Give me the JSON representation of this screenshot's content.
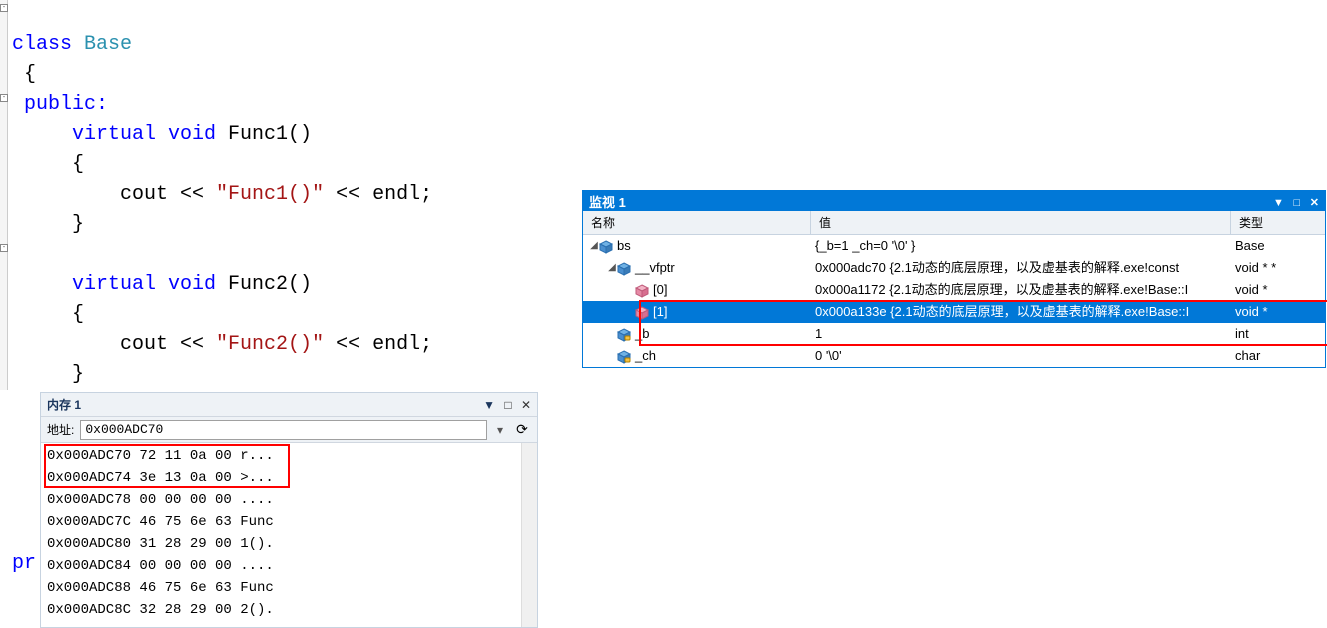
{
  "code": {
    "l1a": "class",
    "l1b": " Base",
    "l2": " {",
    "l3": " public:",
    "l4a": "     virtual",
    "l4b": " void",
    "l4c": " Func1()",
    "l5": "     {",
    "l6a": "         cout << ",
    "l6str": "\"Func1()\"",
    "l6b": " << endl;",
    "l7": "     }",
    "l8": "",
    "l9a": "     virtual",
    "l9b": " void",
    "l9c": " Func2()",
    "l10": "     {",
    "l11a": "         cout << ",
    "l11str": "\"Func2()\"",
    "l11b": " << endl;",
    "l12": "     }",
    "pri": "pr"
  },
  "mem": {
    "title": "内存 1",
    "addr_label": "地址:",
    "addr_value": "0x000ADC70",
    "rows": [
      {
        "a": "0x000ADC70",
        "b": "72 11 0a 00",
        "t": "r..."
      },
      {
        "a": "0x000ADC74",
        "b": "3e 13 0a 00",
        "t": ">..."
      },
      {
        "a": "0x000ADC78",
        "b": "00 00 00 00",
        "t": "...."
      },
      {
        "a": "0x000ADC7C",
        "b": "46 75 6e 63",
        "t": "Func"
      },
      {
        "a": "0x000ADC80",
        "b": "31 28 29 00",
        "t": "1()."
      },
      {
        "a": "0x000ADC84",
        "b": "00 00 00 00",
        "t": "...."
      },
      {
        "a": "0x000ADC88",
        "b": "46 75 6e 63",
        "t": "Func"
      },
      {
        "a": "0x000ADC8C",
        "b": "32 28 29 00",
        "t": "2()."
      }
    ]
  },
  "watch": {
    "title": "监视 1",
    "hdr_name": "名称",
    "hdr_value": "值",
    "hdr_type": "类型",
    "rows": [
      {
        "indent": 0,
        "exp": "▼",
        "icon": "blue",
        "name": "bs",
        "value": "{_b=1 _ch=0 '\\0' }",
        "type": "Base",
        "sel": false
      },
      {
        "indent": 1,
        "exp": "▼",
        "icon": "blue",
        "name": "__vfptr",
        "value": "0x000adc70 {2.1动态的底层原理，以及虚基表的解释.exe!const",
        "type": "void * *",
        "sel": false
      },
      {
        "indent": 2,
        "exp": "",
        "icon": "pink",
        "name": "[0]",
        "value": "0x000a1172 {2.1动态的底层原理，以及虚基表的解释.exe!Base::I",
        "type": "void *",
        "sel": false
      },
      {
        "indent": 2,
        "exp": "",
        "icon": "pink",
        "name": "[1]",
        "value": "0x000a133e {2.1动态的底层原理，以及虚基表的解释.exe!Base::I",
        "type": "void *",
        "sel": true
      },
      {
        "indent": 1,
        "exp": "",
        "icon": "lock",
        "name": "_b",
        "value": "1",
        "type": "int",
        "sel": false
      },
      {
        "indent": 1,
        "exp": "",
        "icon": "lock",
        "name": "_ch",
        "value": "0 '\\0'",
        "type": "char",
        "sel": false
      }
    ]
  }
}
